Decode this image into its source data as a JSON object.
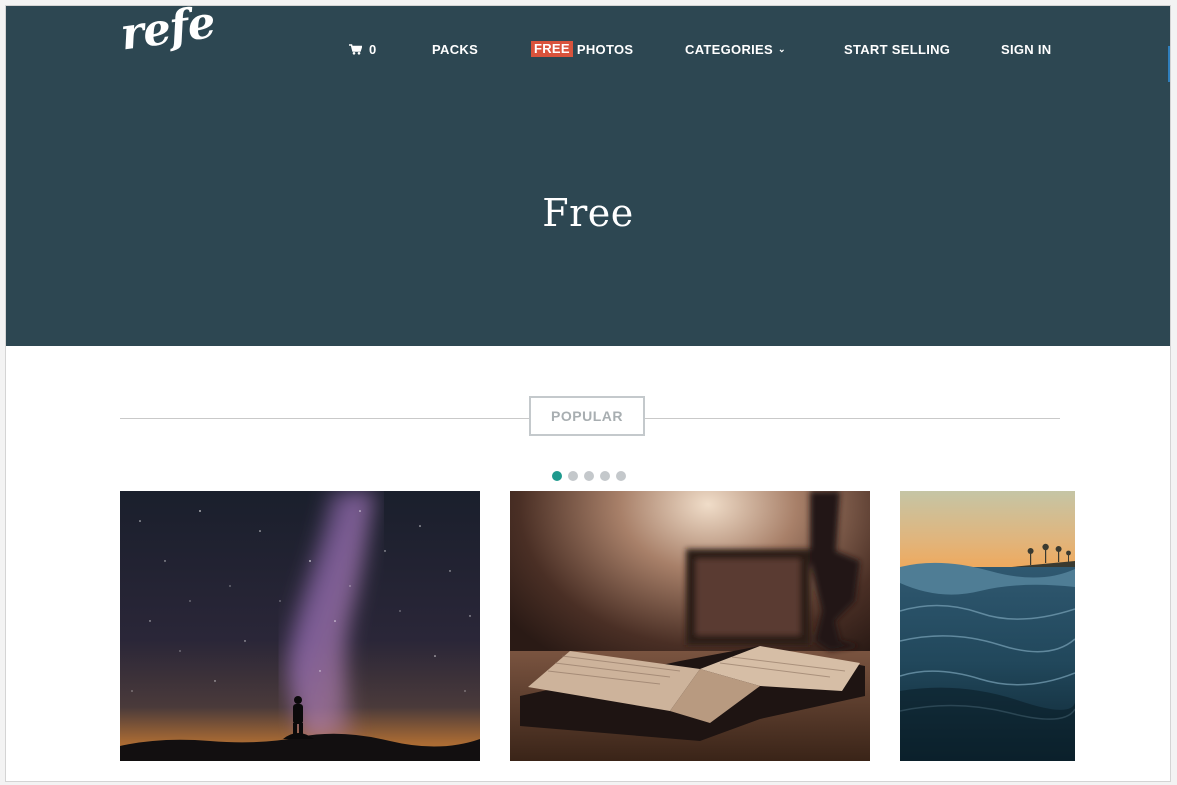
{
  "brand": {
    "logo": "refe"
  },
  "nav": {
    "cart_count": "0",
    "packs": "PACKS",
    "free_badge": "FREE",
    "photos": "PHOTOS",
    "categories": "CATEGORIES",
    "start_selling": "START SELLING",
    "sign_in": "SIGN IN"
  },
  "hero": {
    "title": "Free"
  },
  "section": {
    "heading": "POPULAR"
  },
  "carousel": {
    "dot_count": 5,
    "active_index": 0
  },
  "photos": [
    {
      "subject": "milky-way-silhouette"
    },
    {
      "subject": "open-book-lamp"
    },
    {
      "subject": "ocean-wave-sunset"
    }
  ],
  "colors": {
    "hero_bg": "#2d4752",
    "accent": "#d9533c",
    "active_dot": "#1f9a8e",
    "muted": "#a8aeb1"
  }
}
